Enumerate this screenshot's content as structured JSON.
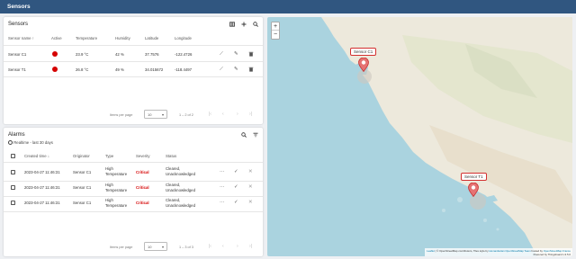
{
  "topbar": {
    "title": "Sensors"
  },
  "sensors": {
    "title": "Sensors",
    "icons": [
      "map-icon",
      "add-icon",
      "search-icon"
    ],
    "columns": [
      "Sensor name",
      "Active",
      "Temperature",
      "Humidity",
      "Latitude",
      "Longitude"
    ],
    "rows": [
      {
        "name": "Sensor C1",
        "temperature": "23.9 °C",
        "humidity": "42 %",
        "latitude": "37.7576",
        "longitude": "-122.4726"
      },
      {
        "name": "Sensor T1",
        "temperature": "26.8 °C",
        "humidity": "49 %",
        "latitude": "34.015672",
        "longitude": "-118.4497"
      }
    ],
    "pager": {
      "items_label": "Items per page",
      "page_size": "10",
      "range": "1 – 2 of 2"
    }
  },
  "alarms": {
    "title": "Alarms",
    "filter": "Realtime - last 30 days",
    "columns": [
      "Created time",
      "Originator",
      "Type",
      "Severity",
      "Status"
    ],
    "rows": [
      {
        "time": "2023-04-27 11:46:31",
        "originator": "Sensor C1",
        "type_line1": "High",
        "type_line2": "Temperature",
        "severity": "Critical",
        "status_line1": "Cleared,",
        "status_line2": "Unacknowledged"
      },
      {
        "time": "2023-04-27 11:46:31",
        "originator": "Sensor C1",
        "type_line1": "High",
        "type_line2": "Temperature",
        "severity": "Critical",
        "status_line1": "Cleared,",
        "status_line2": "Unacknowledged"
      },
      {
        "time": "2023-04-27 11:46:31",
        "originator": "Sensor C1",
        "type_line1": "High",
        "type_line2": "Temperature",
        "severity": "Critical",
        "status_line1": "Cleared,",
        "status_line2": "Unacknowledged"
      }
    ],
    "pager": {
      "items_label": "Items per page",
      "page_size": "10",
      "range": "1 – 3 of 3"
    }
  },
  "map": {
    "zoom_in": "+",
    "zoom_out": "−",
    "markers": [
      {
        "label": "Sensor C1"
      },
      {
        "label": "Sensor T1"
      }
    ],
    "attribution_leaflet": "Leaflet",
    "attribution_text1": " | © OpenStreetMap contributors, Tiles style by ",
    "attribution_hot": "Humanitarian OpenStreetMap Team",
    "attribution_text2": " hosted by ",
    "attribution_osmfr": "OpenStreetMap France",
    "powered": "Powered by Thingsboard v.3.5.0"
  },
  "colors": {
    "header": "#305680",
    "critical": "#d50000",
    "water": "#aad3df",
    "land": "#f2efe9"
  }
}
